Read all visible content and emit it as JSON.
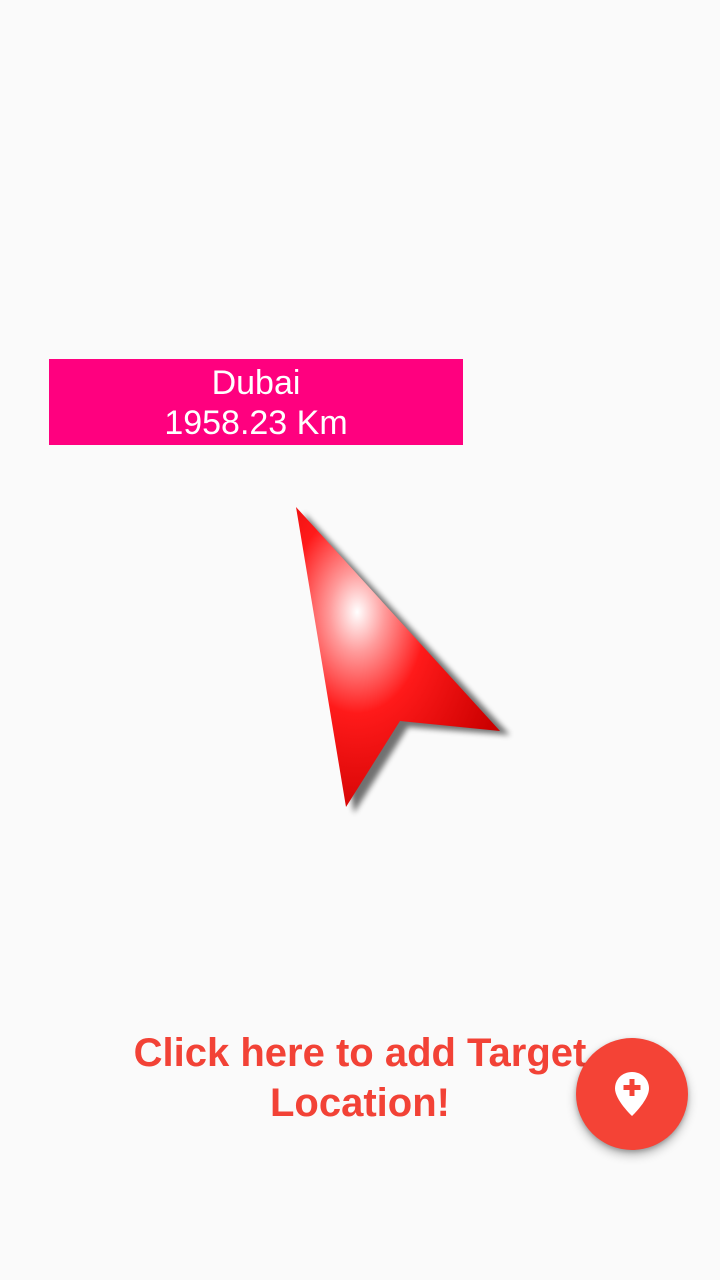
{
  "target": {
    "name": "Dubai",
    "distance": "1958.23 Km"
  },
  "compass": {
    "icon": "navigation-arrow-icon",
    "color": "#ff0000"
  },
  "prompt": {
    "text": "Click here to add Target Location!"
  },
  "fab": {
    "icon": "add-location-icon",
    "color": "#f44336"
  },
  "colors": {
    "background": "#fafafa",
    "target_box": "#ff007f",
    "accent": "#f24236"
  }
}
